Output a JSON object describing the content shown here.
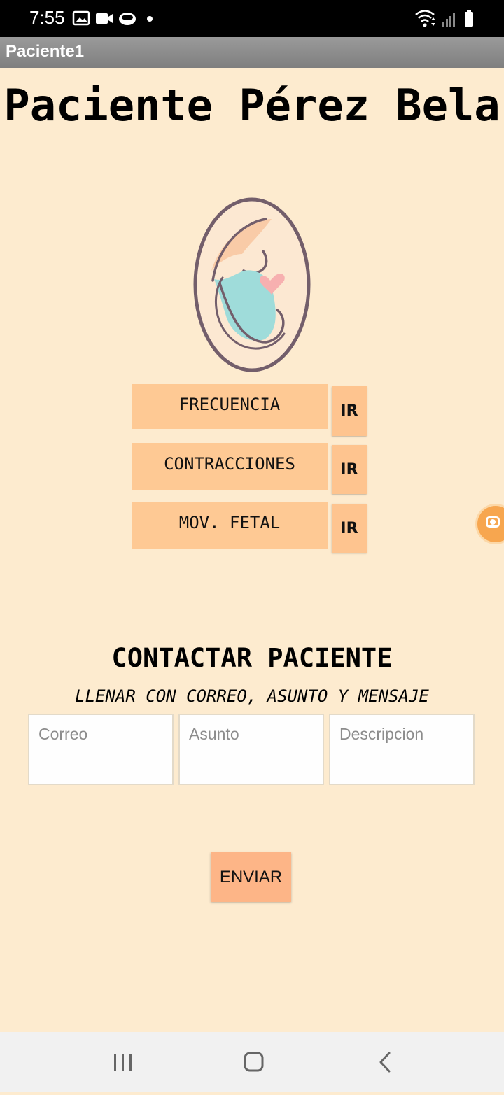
{
  "status_bar": {
    "time": "7:55",
    "left_icons": [
      "image-icon",
      "video-icon",
      "messenger-icon",
      "dot-icon"
    ],
    "right_icons": [
      "wifi-icon",
      "signal-icon",
      "battery-icon"
    ]
  },
  "app_bar": {
    "title": "Paciente1"
  },
  "patient": {
    "title": "Paciente Pérez Bela"
  },
  "logo": {
    "icon": "pregnancy-icon",
    "colors": [
      "#F9CBA7",
      "#9FDCDA",
      "#F7B0B0",
      "#735E6B"
    ]
  },
  "metrics": [
    {
      "label": "FRECUENCIA",
      "button": "IR"
    },
    {
      "label": "CONTRACCIONES",
      "button": "IR"
    },
    {
      "label": "MOV. FETAL",
      "button": "IR"
    }
  ],
  "contact": {
    "title": "CONTACTAR PACIENTE",
    "instructions": "LLENAR CON CORREO, ASUNTO Y MENSAJE",
    "email_placeholder": "Correo",
    "subject_placeholder": "Asunto",
    "description_placeholder": "Descripcion",
    "send_label": "ENVIAR"
  },
  "floating_button": {
    "icon": "screen-record-icon"
  },
  "nav_bar": {
    "icons": [
      "recent-apps-icon",
      "home-icon",
      "back-icon"
    ]
  },
  "colors": {
    "background": "#FDEBCF",
    "metric_label": "#FEC994",
    "ir_button": "#FEC48F",
    "send_button": "#FDB587",
    "app_bar": "#8A8A8A"
  }
}
